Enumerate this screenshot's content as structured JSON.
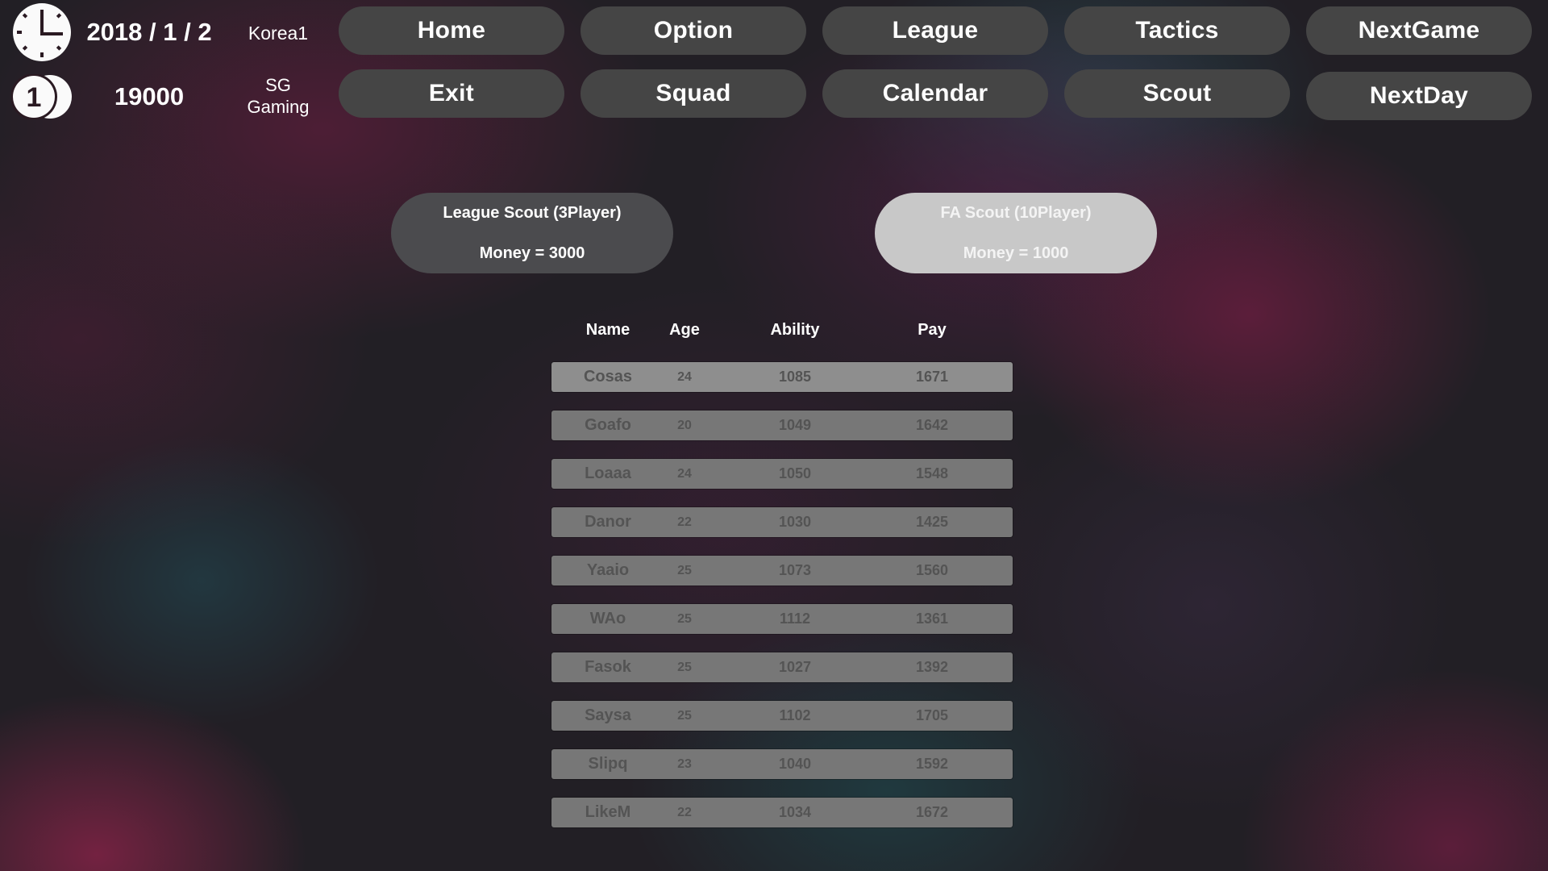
{
  "status": {
    "date": "2018 / 1 / 2",
    "league": "Korea1",
    "money": "19000",
    "team_line1": "SG",
    "team_line2": "Gaming",
    "icons": {
      "clock": "clock-icon",
      "coin": "coin-icon"
    }
  },
  "nav": {
    "row1": [
      "Home",
      "Option",
      "League",
      "Tactics",
      "NextGame"
    ],
    "row2": [
      "Exit",
      "Squad",
      "Calendar",
      "Scout",
      "NextDay"
    ]
  },
  "scout": {
    "league": {
      "title": "League Scout (3Player)",
      "money": "Money  =  3000"
    },
    "fa": {
      "title": "FA Scout (10Player)",
      "money": "Money  =  1000"
    }
  },
  "table": {
    "headers": {
      "name": "Name",
      "age": "Age",
      "ability": "Ability",
      "pay": "Pay"
    },
    "rows": [
      {
        "name": "Cosas",
        "age": "24",
        "ability": "1085",
        "pay": "1671"
      },
      {
        "name": "Goafo",
        "age": "20",
        "ability": "1049",
        "pay": "1642"
      },
      {
        "name": "Loaaa",
        "age": "24",
        "ability": "1050",
        "pay": "1548"
      },
      {
        "name": "Danor",
        "age": "22",
        "ability": "1030",
        "pay": "1425"
      },
      {
        "name": "Yaaio",
        "age": "25",
        "ability": "1073",
        "pay": "1560"
      },
      {
        "name": "WAo",
        "age": "25",
        "ability": "1112",
        "pay": "1361"
      },
      {
        "name": "Fasok",
        "age": "25",
        "ability": "1027",
        "pay": "1392"
      },
      {
        "name": "Saysa",
        "age": "25",
        "ability": "1102",
        "pay": "1705"
      },
      {
        "name": "Slipq",
        "age": "23",
        "ability": "1040",
        "pay": "1592"
      },
      {
        "name": "LikeM",
        "age": "22",
        "ability": "1034",
        "pay": "1672"
      }
    ]
  },
  "colors": {
    "nav_button": "#454545",
    "scout_league_button": "#4b4b4e",
    "scout_fa_button": "#c8c8c8",
    "row": "#777777",
    "row_highlight": "#8e8e8e",
    "row_text": "#545454"
  }
}
